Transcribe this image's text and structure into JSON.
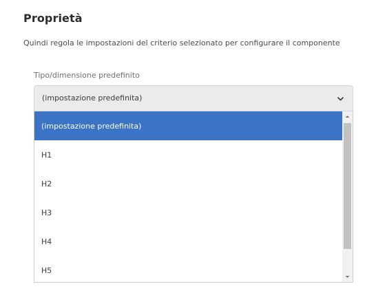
{
  "section": {
    "title": "Proprietà",
    "description": "Quindi regola le impostazioni del criterio selezionato per configurare il componente"
  },
  "field": {
    "label": "Tipo/dimensione predefinito",
    "selected_value": "(impostazione predefinita)",
    "options": [
      {
        "label": "(impostazione predefinita)",
        "selected": true
      },
      {
        "label": "H1",
        "selected": false
      },
      {
        "label": "H2",
        "selected": false
      },
      {
        "label": "H3",
        "selected": false
      },
      {
        "label": "H4",
        "selected": false
      },
      {
        "label": "H5",
        "selected": false
      }
    ]
  },
  "icons": {
    "dropdown": "chevron-down-icon",
    "scroll_up": "scroll-up-arrow-icon",
    "scroll_down": "scroll-down-arrow-icon"
  },
  "colors": {
    "selected_option_bg": "#3b73c6",
    "trigger_bg": "#ebebeb",
    "scroll_thumb": "#c1c1c1"
  }
}
